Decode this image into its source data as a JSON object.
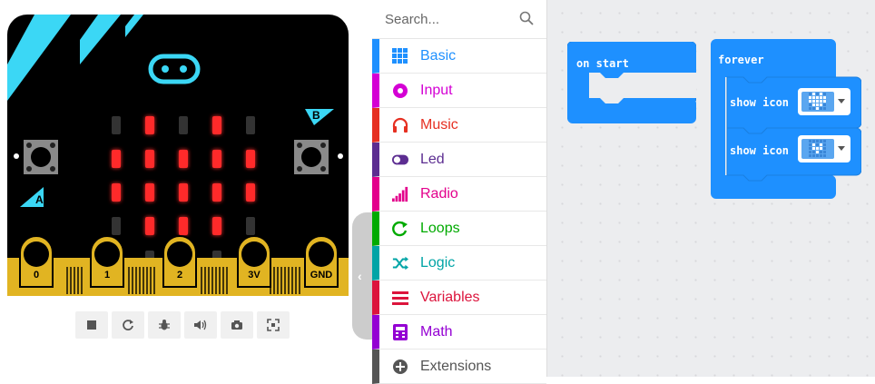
{
  "simulator": {
    "button_a_label": "A",
    "button_b_label": "B",
    "pins": [
      "0",
      "1",
      "2",
      "3V",
      "GND"
    ],
    "led_matrix": [
      [
        0,
        1,
        0,
        1,
        0
      ],
      [
        1,
        1,
        1,
        1,
        1
      ],
      [
        1,
        1,
        1,
        1,
        1
      ],
      [
        0,
        1,
        1,
        1,
        0
      ],
      [
        0,
        0,
        1,
        0,
        0
      ]
    ],
    "toolbar": [
      "stop-icon",
      "restart-icon",
      "debug-icon",
      "sound-icon",
      "screenshot-icon",
      "fullscreen-icon"
    ]
  },
  "toolbox": {
    "search_placeholder": "Search...",
    "categories": [
      {
        "label": "Basic",
        "color": "#1e90ff",
        "icon": "grid-icon"
      },
      {
        "label": "Input",
        "color": "#d400d4",
        "icon": "target-icon"
      },
      {
        "label": "Music",
        "color": "#e63022",
        "icon": "headphones-icon"
      },
      {
        "label": "Led",
        "color": "#5c2d91",
        "icon": "toggle-icon"
      },
      {
        "label": "Radio",
        "color": "#e3008c",
        "icon": "signal-bars-icon"
      },
      {
        "label": "Loops",
        "color": "#00aa00",
        "icon": "loop-arrow-icon"
      },
      {
        "label": "Logic",
        "color": "#00a4a6",
        "icon": "shuffle-icon"
      },
      {
        "label": "Variables",
        "color": "#dc143c",
        "icon": "list-icon"
      },
      {
        "label": "Math",
        "color": "#9400d3",
        "icon": "calculator-icon"
      },
      {
        "label": "Extensions",
        "color": "#555555",
        "icon": "plus-circle-icon"
      }
    ]
  },
  "workspace": {
    "on_start_label": "on start",
    "forever_label": "forever",
    "show_icon_label_1": "show icon",
    "show_icon_label_2": "show icon",
    "block_color": "#1e90ff"
  }
}
